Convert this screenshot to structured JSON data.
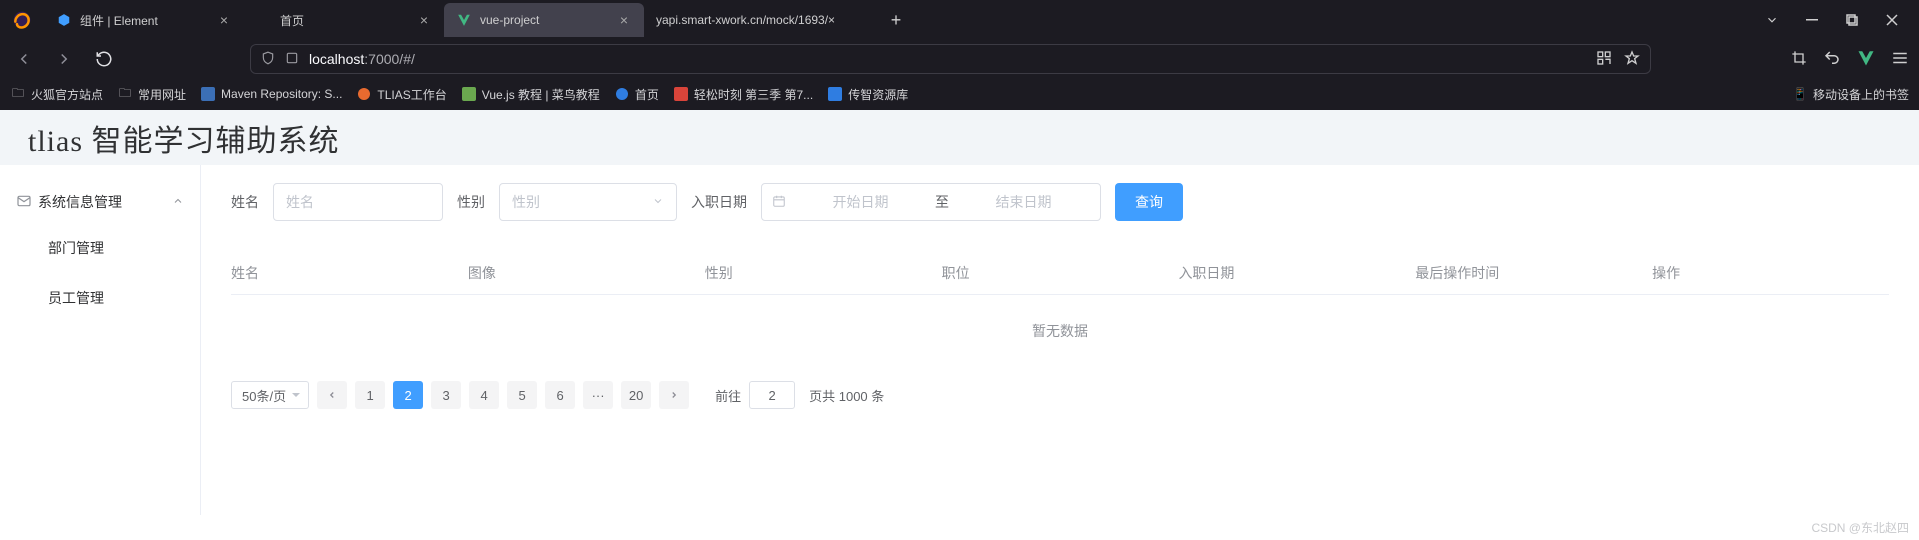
{
  "browser": {
    "tabs": [
      {
        "title": "组件 | Element",
        "favicon": "blue-cube"
      },
      {
        "title": "首页",
        "favicon": ""
      },
      {
        "title": "vue-project",
        "favicon": "vue",
        "active": true
      },
      {
        "title": "yapi.smart-xwork.cn/mock/1693/×",
        "favicon": "",
        "noclose": true
      }
    ],
    "url_host": "localhost",
    "url_rest": ":7000/#/",
    "bookmarks": [
      "火狐官方站点",
      "常用网址",
      "Maven Repository: S...",
      "TLIAS工作台",
      "Vue.js 教程 | 菜鸟教程",
      "首页",
      "轻松时刻 第三季 第7...",
      "传智资源库"
    ],
    "bookbar_right": "移动设备上的书签"
  },
  "page": {
    "title": "tlias 智能学习辅助系统",
    "sidebar": {
      "group": "系统信息管理",
      "items": [
        "部门管理",
        "员工管理"
      ]
    },
    "form": {
      "name_label": "姓名",
      "name_ph": "姓名",
      "gender_label": "性别",
      "gender_ph": "性别",
      "hiredate_label": "入职日期",
      "start_ph": "开始日期",
      "range_sep": "至",
      "end_ph": "结束日期",
      "search_btn": "查询"
    },
    "table": {
      "cols": [
        "姓名",
        "图像",
        "性别",
        "职位",
        "入职日期",
        "最后操作时间",
        "操作"
      ],
      "empty": "暂无数据"
    },
    "pagination": {
      "sizer": "50条/页",
      "pages": [
        "1",
        "2",
        "3",
        "4",
        "5",
        "6",
        "···",
        "20"
      ],
      "active_page": "2",
      "goto_label": "前往",
      "goto_value": "2",
      "total_prefix": "页共",
      "total_count": "1000",
      "total_suffix": "条"
    }
  },
  "watermark": "CSDN @东北赵四"
}
